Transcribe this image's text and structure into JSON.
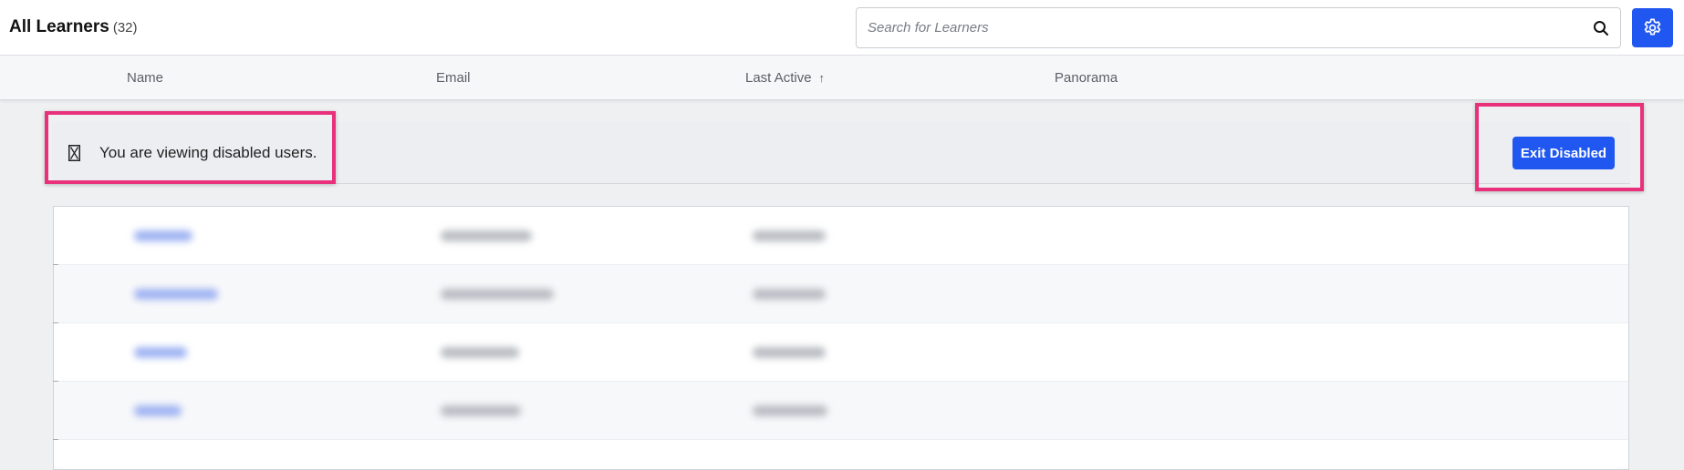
{
  "header": {
    "title": "All Learners",
    "count": "(32)",
    "search_placeholder": "Search for Learners",
    "search_value": ""
  },
  "columns": [
    {
      "label": "Name",
      "active": false
    },
    {
      "label": "Email",
      "active": false
    },
    {
      "label": "Last Active",
      "active": true,
      "sort": "ascending",
      "sort_glyph": "↑"
    },
    {
      "label": "Panorama",
      "active": false
    }
  ],
  "banner": {
    "message": "You are viewing disabled users.",
    "icon": "hourglass-icon",
    "exit_label": "Exit Disabled"
  },
  "colors": {
    "accent": "#1f57f0",
    "highlight": "#e8317a",
    "active_column": "#2156e6"
  },
  "table": {
    "rows_visible": 4,
    "content": "blurred"
  }
}
